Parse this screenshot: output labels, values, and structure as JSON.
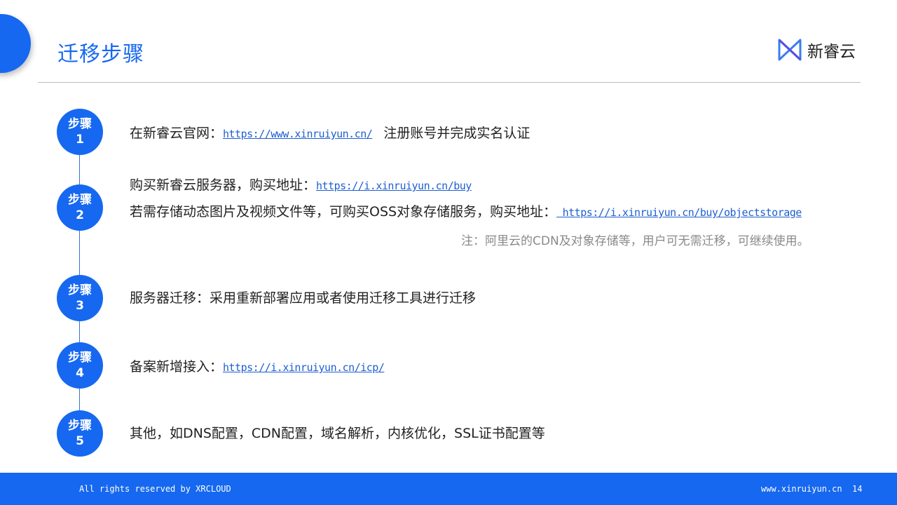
{
  "page": {
    "title": "迁移步骤"
  },
  "logo": {
    "text": "新睿云",
    "icon": "xinruiyun-logo-icon"
  },
  "steps": [
    {
      "label": "步骤",
      "number": "1"
    },
    {
      "label": "步骤",
      "number": "2"
    },
    {
      "label": "步骤",
      "number": "3"
    },
    {
      "label": "步骤",
      "number": "4"
    },
    {
      "label": "步骤",
      "number": "5"
    }
  ],
  "step1": {
    "prefix": "在新睿云官网：",
    "link": "https://www.xinruiyun.cn/",
    "suffix": "注册账号并完成实名认证"
  },
  "step2": {
    "line1_prefix": "购买新睿云服务器，购买地址：",
    "line1_link": "https://i.xinruiyun.cn/buy",
    "line2_prefix": "若需存储动态图片及视频文件等，可购买OSS对象存储服务，购买地址：",
    "line2_link": " https://i.xinruiyun.cn/buy/objectstorage",
    "note": "注：阿里云的CDN及对象存储等，用户可无需迁移，可继续使用。"
  },
  "step3": {
    "text": "服务器迁移：采用重新部署应用或者使用迁移工具进行迁移"
  },
  "step4": {
    "prefix": "备案新增接入：",
    "link": "https://i.xinruiyun.cn/icp/"
  },
  "step5": {
    "text": "其他，如DNS配置，CDN配置，域名解析，内核优化，SSL证书配置等"
  },
  "footer": {
    "copyright": "All rights reserved by XRCLOUD",
    "website": "www.xinruiyun.cn",
    "page_number": "14"
  },
  "colors": {
    "accent": "#1668f0",
    "link": "#1f5fd0",
    "note": "#8a8a8a"
  }
}
